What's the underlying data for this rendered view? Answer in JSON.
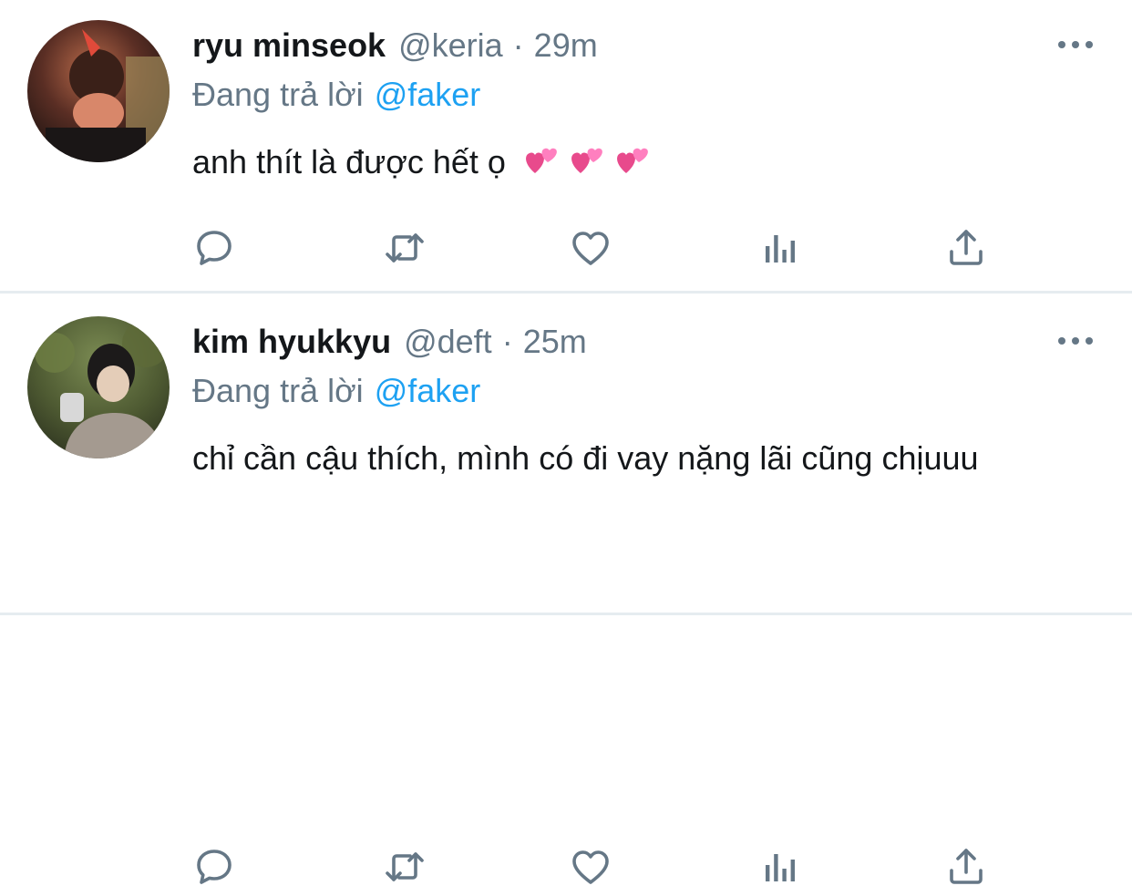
{
  "tweets": [
    {
      "name": "ryu minseok",
      "handle": "@keria",
      "separator": "·",
      "time": "29m",
      "reply_prefix": "Đang trả lời",
      "reply_mention": "@faker",
      "text": "anh thít là được hết ọ",
      "emoji": [
        "💞",
        "💞",
        "💞"
      ]
    },
    {
      "name": "kim hyukkyu",
      "handle": "@deft",
      "separator": "·",
      "time": "25m",
      "reply_prefix": "Đang trả lời",
      "reply_mention": "@faker",
      "text": "chỉ cần cậu thích, mình có đi vay nặng lãi cũng chịuuu"
    }
  ],
  "icons": {
    "more": "more-dots-icon",
    "reply": "reply-bubble-icon",
    "retweet": "retweet-icon",
    "like": "heart-icon",
    "stats": "analytics-bars-icon",
    "share": "share-upload-icon"
  },
  "colors": {
    "name": "#14171a",
    "secondary": "#657786",
    "mention": "#1da1f2",
    "divider": "#e6ecf0"
  }
}
